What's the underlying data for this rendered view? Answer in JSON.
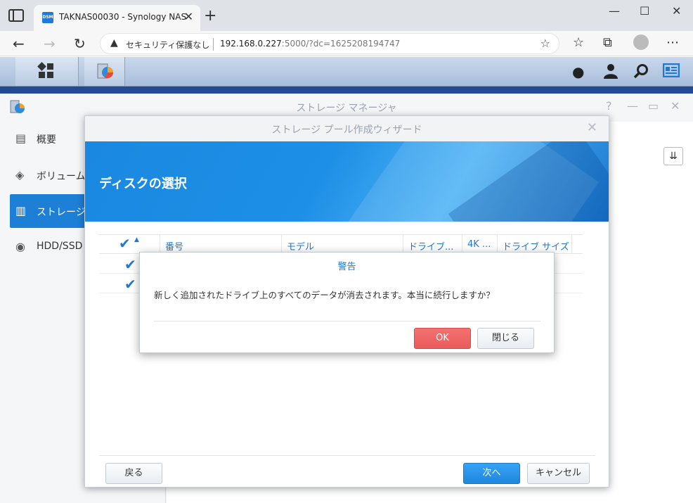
{
  "browser": {
    "tab_title": "TAKNAS00030 - Synology NAS",
    "favicon_text": "DSM",
    "security_label": "セキュリティ保護なし",
    "url_host": "192.168.0.227",
    "url_path": ":5000/?dc=1625208194747"
  },
  "storage_manager": {
    "title": "ストレージ マネージャ",
    "sidebar": [
      {
        "label": "概要",
        "icon": "overview-icon"
      },
      {
        "label": "ボリューム",
        "icon": "volume-icon"
      },
      {
        "label": "ストレージ",
        "icon": "storage-icon",
        "active": true
      },
      {
        "label": "HDD/SSD",
        "icon": "hdd-icon"
      }
    ]
  },
  "wizard": {
    "title": "ストレージ プール作成ウィザード",
    "banner_title": "ディスクの選択",
    "columns": [
      "番号",
      "モデル",
      "ドライブ...",
      "4K ...",
      "ドライブ サイズ"
    ],
    "back_label": "戻る",
    "next_label": "次へ",
    "cancel_label": "キャンセル"
  },
  "warning": {
    "title": "警告",
    "message": "新しく追加されたドライブ上のすべてのデータが消去されます。本当に続行しますか？",
    "ok_label": "OK",
    "close_label": "閉じる"
  },
  "colors": {
    "accent": "#1f78d1",
    "ok_button": "#e95b5b",
    "banner": "#1d8fe6"
  }
}
